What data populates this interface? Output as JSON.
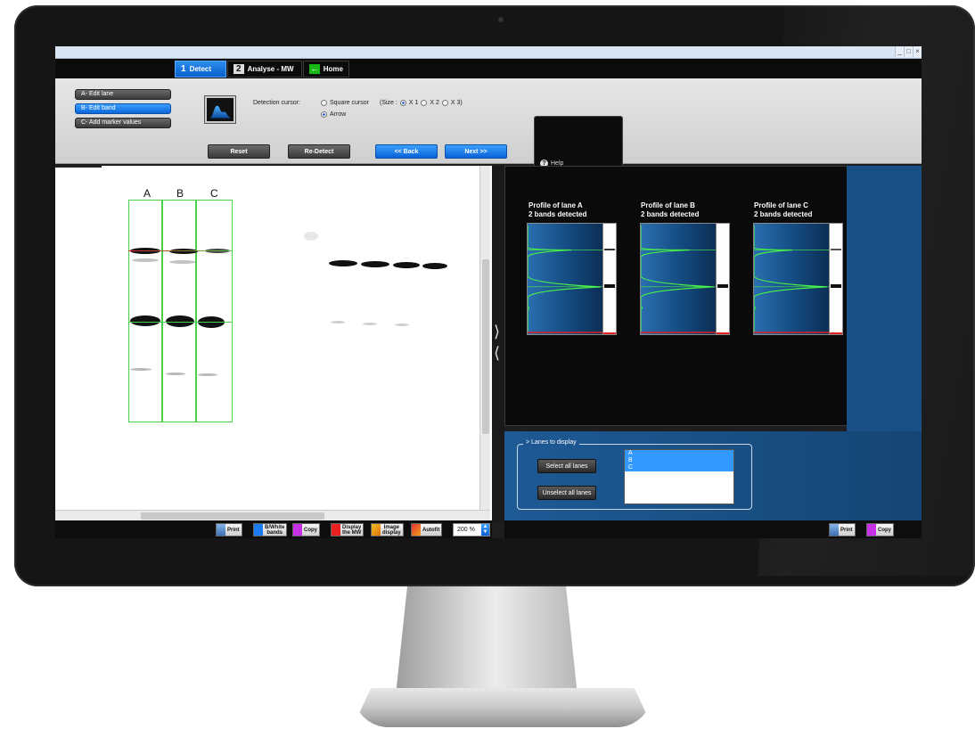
{
  "tabs": [
    {
      "num": "1",
      "label": "Detect"
    },
    {
      "num": "2",
      "label": "Analyse - MW"
    },
    {
      "label": "Home"
    }
  ],
  "side_buttons": [
    "A- Edit lane",
    "B- Edit band",
    "C- Add marker values"
  ],
  "detection": {
    "label": "Detection cursor:",
    "square": "Square cursor",
    "size_label": "(Size :",
    "x1": "X 1",
    "x2": "X 2",
    "x3": "X 3)",
    "arrow": "Arrow"
  },
  "actions": {
    "reset": "Reset",
    "redetect": "Re-Detect",
    "back": "<< Back",
    "next": "Next >>"
  },
  "help": "Help",
  "lanes": [
    "A",
    "B",
    "C"
  ],
  "profiles": [
    {
      "title": "Profile of lane A",
      "subtitle": "2 bands detected"
    },
    {
      "title": "Profile of lane B",
      "subtitle": "2 bands detected"
    },
    {
      "title": "Profile of lane C",
      "subtitle": "2 bands detected"
    }
  ],
  "lanes_panel": {
    "legend": "> Lanes to display",
    "select_all": "Select all lanes",
    "unselect_all": "Unselect all lanes",
    "list": [
      "A",
      "B",
      "C"
    ]
  },
  "bottom_left": {
    "print": "Print",
    "bw_line1": "B/White",
    "bw_line2": "bands",
    "copy": "Copy",
    "mw_line1": "Display",
    "mw_line2": "the MW",
    "img_line1": "Image",
    "img_line2": "display",
    "autofit": "Autofit",
    "zoom": "200 %"
  },
  "bottom_right": {
    "print": "Print",
    "copy": "Copy"
  },
  "colors": {
    "accent_blue": "#0a62d6",
    "panel_blue": "#1a4f85",
    "detect_green": "#4ad04a",
    "marker_red": "#e02020"
  }
}
